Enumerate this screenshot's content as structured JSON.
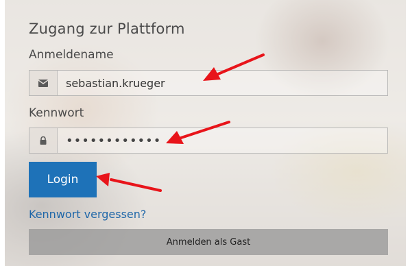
{
  "form": {
    "title": "Zugang zur Plattform",
    "username_label": "Anmeldename",
    "username_value": "sebastian.krueger",
    "username_icon": "envelope-icon",
    "password_label": "Kennwort",
    "password_value": "••••••••••••",
    "password_icon": "lock-icon",
    "login_label": "Login",
    "forgot_link": "Kennwort vergessen?",
    "guest_label": "Anmelden als Gast"
  },
  "colors": {
    "primary": "#1e72b8",
    "link": "#1e66a8",
    "guest_button": "#969696",
    "annotation_arrow": "#e8141a",
    "text": "#4a4a4a"
  },
  "annotations": [
    "red-arrow-username",
    "red-arrow-password",
    "red-arrow-login"
  ]
}
